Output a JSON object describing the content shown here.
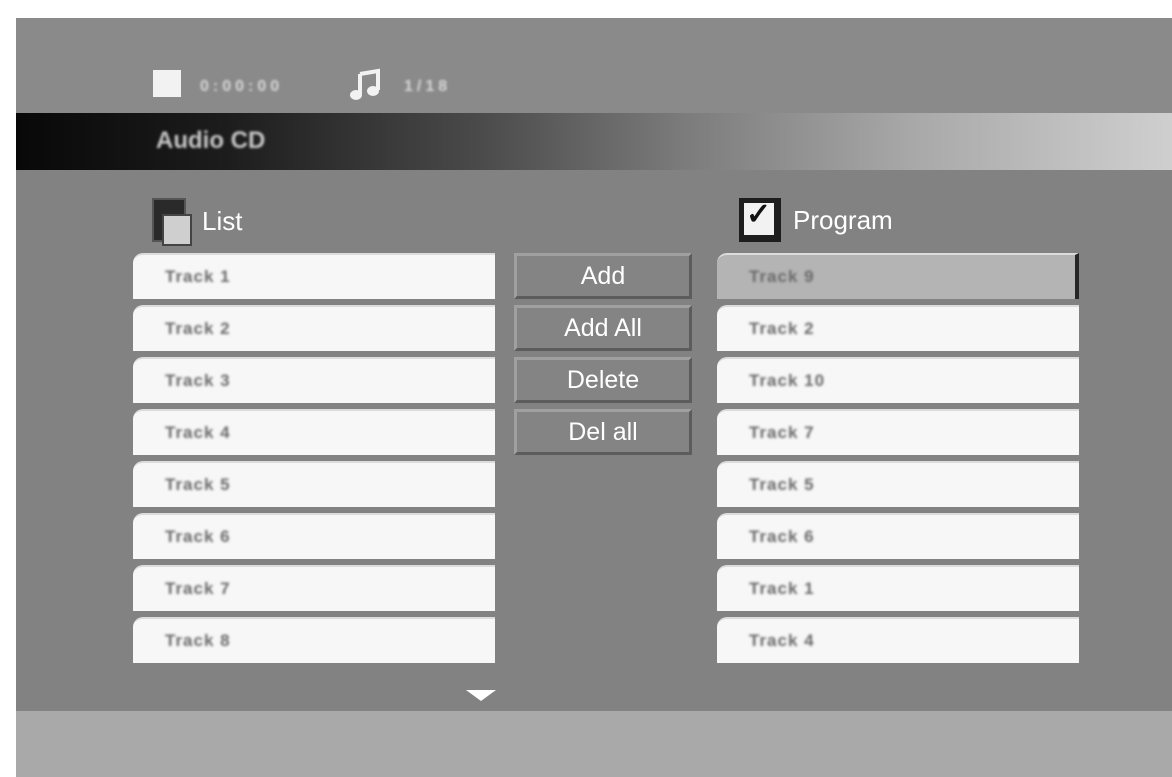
{
  "status": {
    "time": "0:00:00",
    "track_indicator": "1/18"
  },
  "title": "Audio CD",
  "list": {
    "header": "List",
    "items": [
      "Track 1",
      "Track 2",
      "Track 3",
      "Track 4",
      "Track 5",
      "Track 6",
      "Track 7",
      "Track 8"
    ]
  },
  "program": {
    "header": "Program",
    "items": [
      "Track 9",
      "Track 2",
      "Track 10",
      "Track 7",
      "Track 5",
      "Track 6",
      "Track 1",
      "Track 4"
    ]
  },
  "buttons": {
    "add": "Add",
    "add_all": "Add All",
    "delete": "Delete",
    "del_all": "Del all"
  },
  "icons": {
    "stop": "stop-icon",
    "note": "music-note-icon",
    "list": "list-icon",
    "program": "checkbox-icon",
    "scroll": "scroll-down-icon"
  }
}
